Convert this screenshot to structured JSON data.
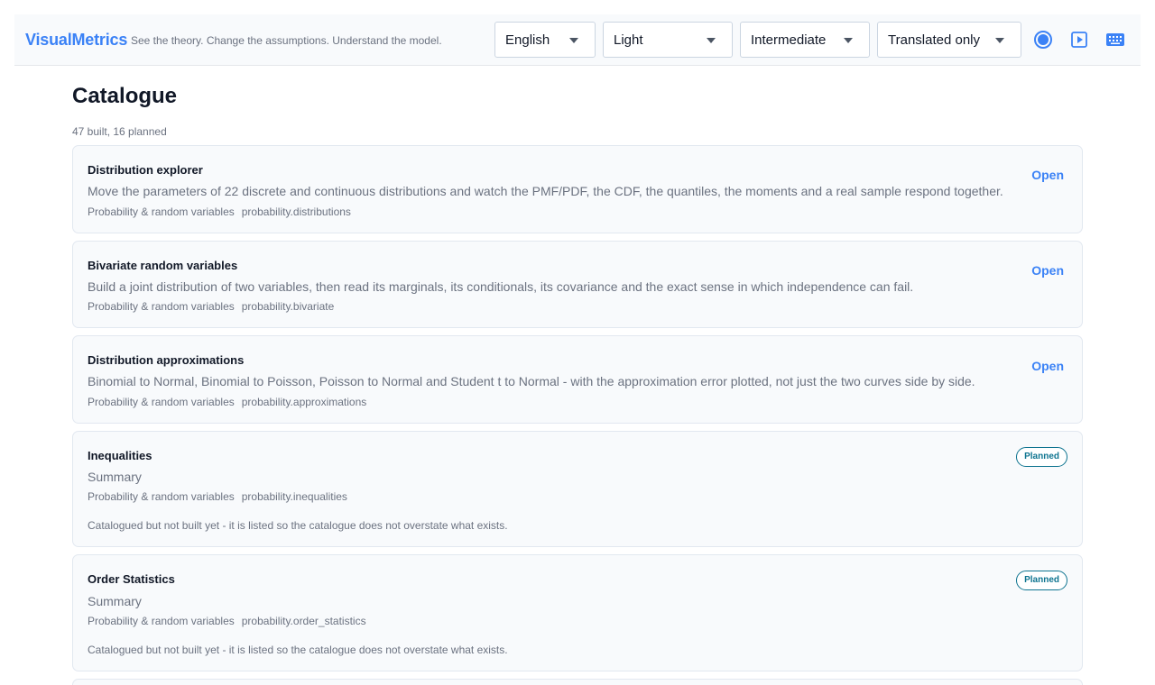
{
  "header": {
    "brand": "VisualMetrics",
    "tagline": "See the theory. Change the assumptions. Understand the model.",
    "selects": {
      "language": "English",
      "theme": "Light",
      "level": "Intermediate",
      "translation": "Translated only"
    },
    "icons": [
      "record-icon",
      "play-icon",
      "keyboard-icon"
    ]
  },
  "page": {
    "title": "Catalogue",
    "count": "47 built, 16 planned"
  },
  "cards": [
    {
      "title": "Distribution explorer",
      "description": "Move the parameters of 22 discrete and continuous distributions and watch the PMF/PDF, the CDF, the quantiles, the moments and a real sample respond together.",
      "category": "Probability & random variables",
      "id": "probability.distributions",
      "action": "Open"
    },
    {
      "title": "Bivariate random variables",
      "description": "Build a joint distribution of two variables, then read its marginals, its conditionals, its covariance and the exact sense in which independence can fail.",
      "category": "Probability & random variables",
      "id": "probability.bivariate",
      "action": "Open"
    },
    {
      "title": "Distribution approximations",
      "description": "Binomial to Normal, Binomial to Poisson, Poisson to Normal and Student t to Normal - with the approximation error plotted, not just the two curves side by side.",
      "category": "Probability & random variables",
      "id": "probability.approximations",
      "action": "Open"
    },
    {
      "title": "Inequalities",
      "description": "Summary",
      "category": "Probability & random variables",
      "id": "probability.inequalities",
      "badge": "Planned",
      "note": "Catalogued but not built yet - it is listed so the catalogue does not overstate what exists."
    },
    {
      "title": "Order Statistics",
      "description": "Summary",
      "category": "Probability & random variables",
      "id": "probability.order_statistics",
      "badge": "Planned",
      "note": "Catalogued but not built yet - it is listed so the catalogue does not overstate what exists."
    }
  ],
  "colors": {
    "accent": "#3b82f6",
    "planned": "#0e7490"
  }
}
